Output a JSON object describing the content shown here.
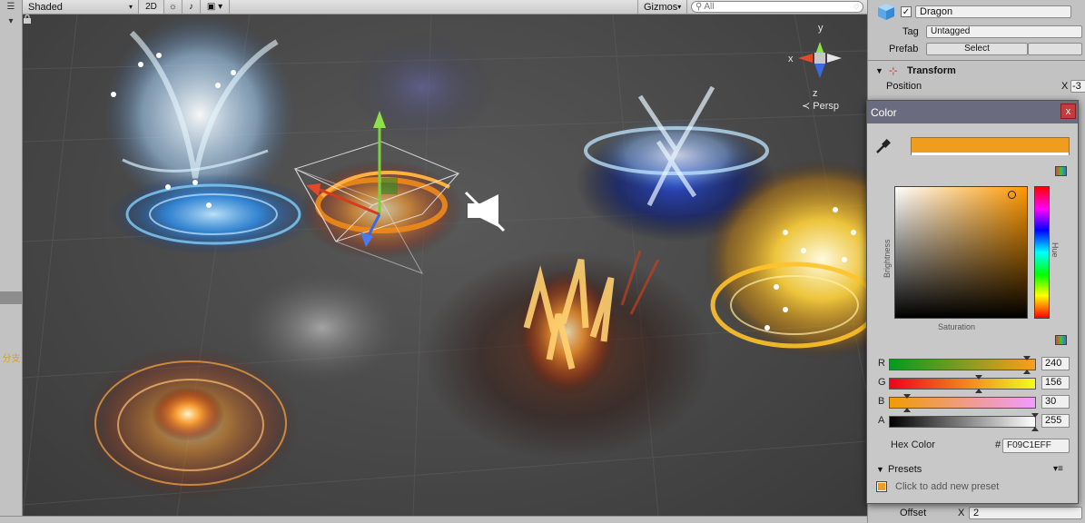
{
  "toolbar": {
    "shading_mode": "Shaded",
    "mode_2d": "2D",
    "gizmos_label": "Gizmos",
    "search_placeholder": "All"
  },
  "scene": {
    "camera_label": "Persp",
    "axes": {
      "y": "y",
      "x": "x",
      "z": "z"
    }
  },
  "left_strip": {
    "tag_text": "分支"
  },
  "inspector": {
    "object_name": "Dragon",
    "active": true,
    "tag_label": "Tag",
    "tag_value": "Untagged",
    "prefab_label": "Prefab",
    "prefab_select": "Select",
    "transform_title": "Transform",
    "position_label": "Position",
    "position_x_label": "X",
    "position_x_value": "-3",
    "offset_label": "Offset",
    "offset_x_label": "X",
    "offset_x_value": "2"
  },
  "color_picker": {
    "title": "Color",
    "close": "x",
    "brightness_label": "Brightness",
    "saturation_label": "Saturation",
    "hue_label": "Hue",
    "current_color": "#F09C1E",
    "r_label": "R",
    "r_value": "240",
    "r_fraction": 0.941,
    "g_label": "G",
    "g_value": "156",
    "g_fraction": 0.612,
    "b_label": "B",
    "b_value": "30",
    "b_fraction": 0.118,
    "a_label": "A",
    "a_value": "255",
    "a_fraction": 1.0,
    "hex_label": "Hex Color",
    "hex_hash": "#",
    "hex_value": "F09C1EFF",
    "presets_label": "Presets",
    "add_preset_text": "Click to add new preset"
  }
}
